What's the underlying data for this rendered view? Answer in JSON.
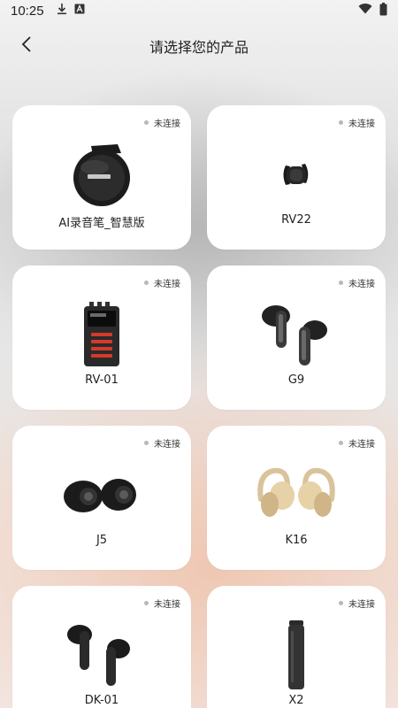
{
  "status_bar": {
    "time": "10:25",
    "icons": [
      "download-icon",
      "text-a-icon",
      "wifi-icon",
      "battery-icon"
    ]
  },
  "header": {
    "back_icon": "chevron-left-icon",
    "title": "请选择您的产品"
  },
  "products": [
    {
      "name": "AI录音笔_智慧版",
      "status": "未连接",
      "image": "round-recorder-icon"
    },
    {
      "name": "RV22",
      "status": "未连接",
      "image": "band-icon"
    },
    {
      "name": "RV-01",
      "status": "未连接",
      "image": "walkie-recorder-icon"
    },
    {
      "name": "G9",
      "status": "未连接",
      "image": "earbuds-icon"
    },
    {
      "name": "J5",
      "status": "未连接",
      "image": "black-earbuds-icon"
    },
    {
      "name": "K16",
      "status": "未连接",
      "image": "open-earbuds-icon"
    },
    {
      "name": "DK-01",
      "status": "未连接",
      "image": "stem-earbuds-icon"
    },
    {
      "name": "X2",
      "status": "未连接",
      "image": "pen-recorder-icon"
    }
  ],
  "colors": {
    "status_dot": "#b8b8b8",
    "card_bg": "#ffffff",
    "text": "#222222"
  }
}
